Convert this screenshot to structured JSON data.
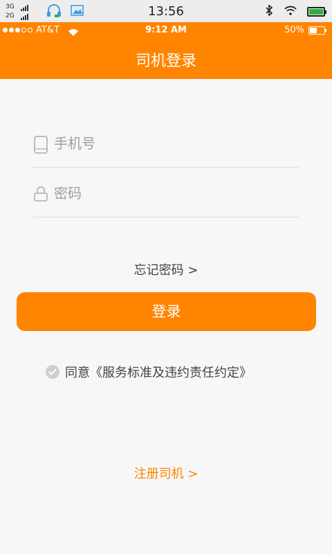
{
  "system_bar": {
    "net1": "3G",
    "net2": "2G",
    "time": "13:56"
  },
  "carrier_bar": {
    "carrier": "AT&T",
    "time": "9:12 AM",
    "battery": "50%"
  },
  "nav": {
    "title": "司机登录"
  },
  "form": {
    "phone_placeholder": "手机号",
    "password_placeholder": "密码",
    "forgot": "忘记密码 >",
    "login": "登录",
    "agree": "同意《服务标准及违约责任约定》",
    "register": "注册司机 >"
  },
  "colors": {
    "accent": "#ff8400",
    "status_green": "#27b53f"
  },
  "icons": [
    "signal-icon",
    "headset-icon",
    "image-icon",
    "bluetooth-icon",
    "wifi-icon",
    "battery-icon",
    "phone-icon",
    "lock-icon",
    "check-icon"
  ]
}
